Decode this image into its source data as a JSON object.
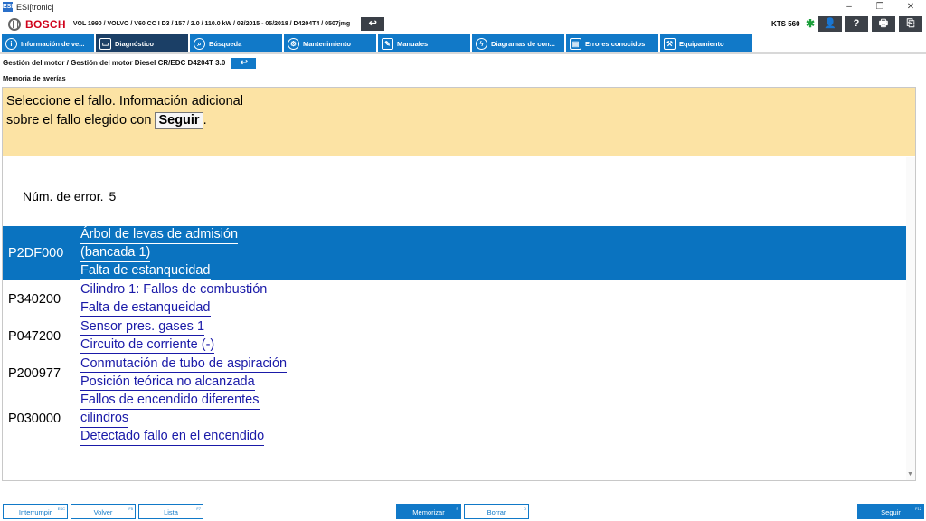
{
  "window": {
    "title": "ESI[tronic]",
    "app_icon": "ESI",
    "controls": [
      "–",
      "❐",
      "✕"
    ]
  },
  "header": {
    "brand": "BOSCH",
    "vehicle": "VOL 1990 / VOLVO / V60 CC I D3 / 157 / 2.0 / 110.0 kW / 03/2015 - 05/2018 / D4204T4 / 0507jmg",
    "device": "KTS 560",
    "back_icon": "↩",
    "bt_icon": "✱",
    "user_icon": "👤",
    "help_icon": "?",
    "print_icon": "🖶",
    "export_icon": "⎘"
  },
  "nav": {
    "tabs": [
      {
        "label": "Información de ve...",
        "icon": "i"
      },
      {
        "label": "Diagnóstico",
        "icon": "▭"
      },
      {
        "label": "Búsqueda",
        "icon": "⌕"
      },
      {
        "label": "Mantenimiento",
        "icon": "⚙"
      },
      {
        "label": "Manuales",
        "icon": "✎"
      },
      {
        "label": "Diagramas de con...",
        "icon": "ϟ"
      },
      {
        "label": "Errores conocidos",
        "icon": "▤"
      },
      {
        "label": "Equipamiento",
        "icon": "⚒"
      }
    ]
  },
  "breadcrumb": "Gestión del motor / Gestión del motor Diesel CR/EDC D4204T 3.0",
  "section": "Memoria de averías",
  "instruction": {
    "line1": "Seleccione el fallo. Información adicional",
    "line2_prefix": "sobre el fallo elegido con",
    "key": "Seguir",
    "suffix": "."
  },
  "error_count": {
    "label": "Núm. de error.",
    "value": "5"
  },
  "errors": [
    {
      "code": "P2DF000",
      "lines": [
        "Árbol de levas de admisión",
        "(bancada 1)",
        "Falta de estanqueidad"
      ]
    },
    {
      "code": "P340200",
      "lines": [
        "Cilindro 1: Fallos de combustión",
        "Falta de estanqueidad"
      ]
    },
    {
      "code": "P047200",
      "lines": [
        "Sensor pres. gases 1",
        "Circuito de corriente (-)"
      ]
    },
    {
      "code": "P200977",
      "lines": [
        "Conmutación de tubo de aspiración",
        "Posición teórica no alcanzada"
      ]
    },
    {
      "code": "P030000",
      "lines": [
        "Fallos de encendido diferentes",
        "cilindros",
        "Detectado fallo en el encendido"
      ]
    }
  ],
  "scroll_arrow": "▼",
  "bottom": {
    "interrumpir": {
      "label": "Interrumpir",
      "key": "ESC"
    },
    "volver": {
      "label": "Volver",
      "key": "F5"
    },
    "lista": {
      "label": "Lista",
      "key": "F7"
    },
    "memorizar": {
      "label": "Memorizar",
      "key": "S"
    },
    "borrar": {
      "label": "Borrar",
      "key": "D"
    },
    "seguir": {
      "label": "Seguir",
      "key": "F12"
    }
  },
  "colors": {
    "accent": "#1179c8",
    "selected_row": "#0a73c0",
    "instruction_bg": "#fce3a4",
    "link": "#1a1aa8",
    "brand_red": "#d0021b"
  }
}
